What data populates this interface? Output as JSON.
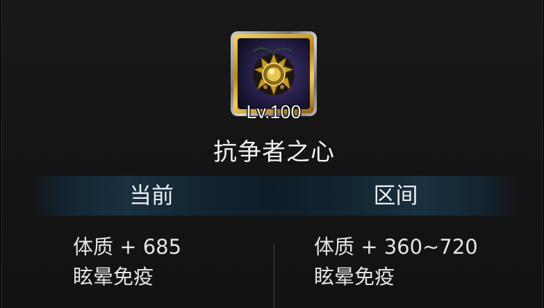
{
  "item": {
    "icon": "amulet-icon",
    "level": "Lv.100",
    "name": "抗争者之心"
  },
  "table": {
    "headers": {
      "current": "当前",
      "range": "区间"
    },
    "current": {
      "stat1": "体质 + 685",
      "stat2": "眩晕免疫"
    },
    "range": {
      "stat1": "体质 + 360~720",
      "stat2": "眩晕免疫"
    }
  },
  "colors": {
    "frame_gold": "#d4a62c",
    "band": "#19303f",
    "text": "#e6e6e6"
  }
}
